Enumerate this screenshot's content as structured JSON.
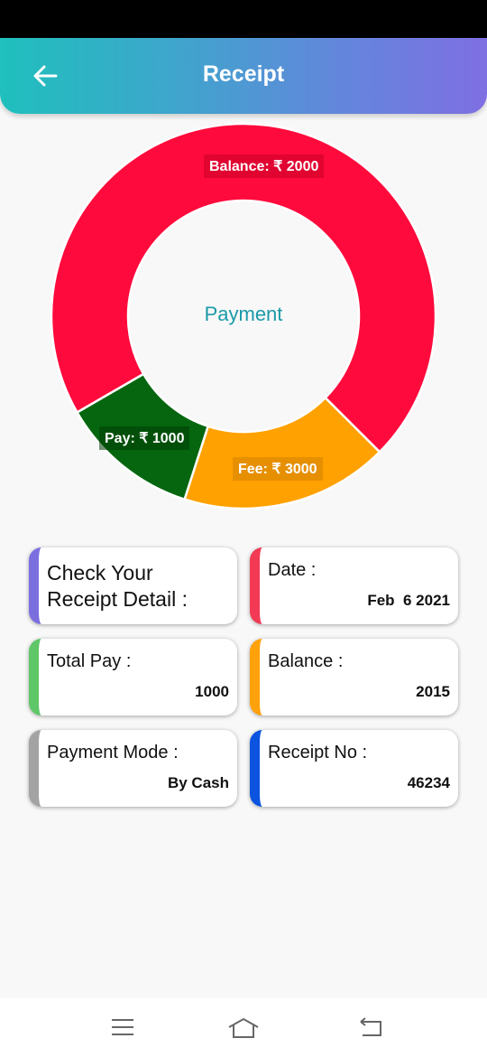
{
  "header": {
    "title": "Receipt",
    "back_icon": "arrow-left-icon"
  },
  "chart_data": {
    "type": "pie",
    "style": "donut",
    "center_text": "Payment",
    "slices": [
      {
        "label": "Balance: ₹ 2000",
        "value": 2000,
        "share_percent": 70.8,
        "color": "#ff0a3c"
      },
      {
        "label": "Fee: ₹ 3000",
        "value": 3000,
        "share_percent": 17.5,
        "color": "#ffa100"
      },
      {
        "label": "Pay: ₹ 1000",
        "value": 1000,
        "share_percent": 11.7,
        "color": "#05660f"
      }
    ]
  },
  "cards": {
    "intro": {
      "text_line1": "Check Your",
      "text_line2": "Receipt Detail :",
      "color": "#7b6fe0"
    },
    "date": {
      "label": "Date :",
      "value": "Feb  6 2021",
      "color": "#f23a55"
    },
    "total_pay": {
      "label": "Total Pay :",
      "value": "1000",
      "color": "#5fc768"
    },
    "balance": {
      "label": "Balance :",
      "value": "2015",
      "color": "#ffa10a"
    },
    "payment_mode": {
      "label": "Payment Mode :",
      "value": "By Cash",
      "color": "#a3a3a3"
    },
    "receipt_no": {
      "label": "Receipt No :",
      "value": "46234",
      "color": "#0c54df"
    }
  },
  "navbar": {
    "icons": [
      "menu-icon",
      "home-icon",
      "back-icon"
    ]
  }
}
